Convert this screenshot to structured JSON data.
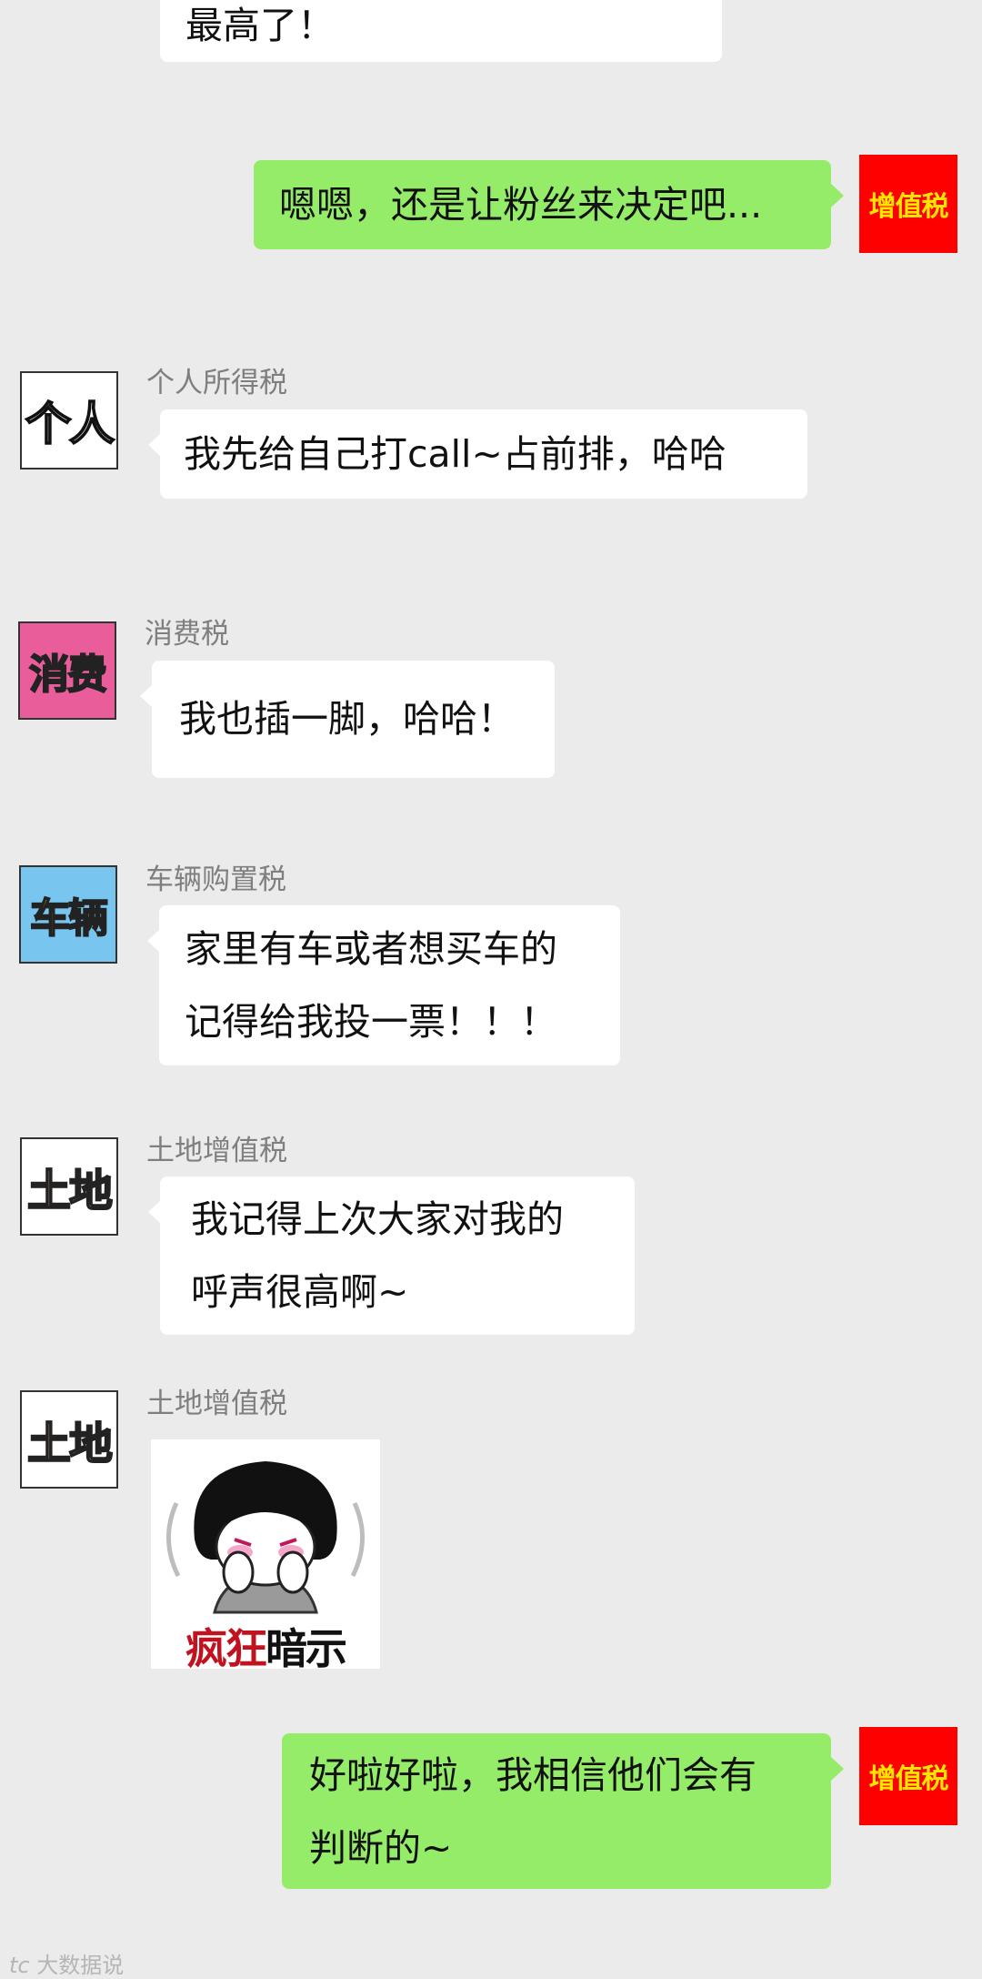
{
  "messages": [
    {
      "side": "in",
      "text": "最高了！"
    },
    {
      "side": "out",
      "sender": "增值税",
      "text": "嗯嗯，还是让粉丝来决定吧..."
    },
    {
      "side": "in",
      "sender": "个人所得税",
      "avatar_text": "个人",
      "text": "我先给自己打call~占前排，哈哈"
    },
    {
      "side": "in",
      "sender": "消费税",
      "avatar_text": "消费",
      "text": "我也插一脚，哈哈！"
    },
    {
      "side": "in",
      "sender": "车辆购置税",
      "avatar_text": "车辆",
      "lines": [
        "家里有车或者想买车的",
        "记得给我投一票！！！"
      ]
    },
    {
      "side": "in",
      "sender": "土地增值税",
      "avatar_text": "土地",
      "lines": [
        "我记得上次大家对我的",
        "呼声很高啊~"
      ]
    },
    {
      "side": "in",
      "sender": "土地增值税",
      "avatar_text": "土地",
      "sticker": {
        "caption_red": "疯狂",
        "caption_black": "暗示"
      }
    },
    {
      "side": "out",
      "sender": "增值税",
      "lines": [
        "好啦好啦，我相信他们会有",
        "判断的~"
      ]
    }
  ],
  "self_avatar_text": "增值税",
  "watermark": {
    "mark": "tc",
    "text": "大数据说"
  },
  "colors": {
    "background": "#ebebeb",
    "bubble_in": "#ffffff",
    "bubble_out": "#95ec69",
    "self_avatar": "#ff0000",
    "consumption_avatar": "#e85d9a",
    "vehicle_avatar": "#78c6f0"
  },
  "icons": [
    "personal-tax-avatar-icon",
    "consumption-tax-avatar-icon",
    "vehicle-tax-avatar-icon",
    "land-tax-avatar-icon",
    "vat-avatar-icon",
    "crazy-hint-sticker"
  ]
}
